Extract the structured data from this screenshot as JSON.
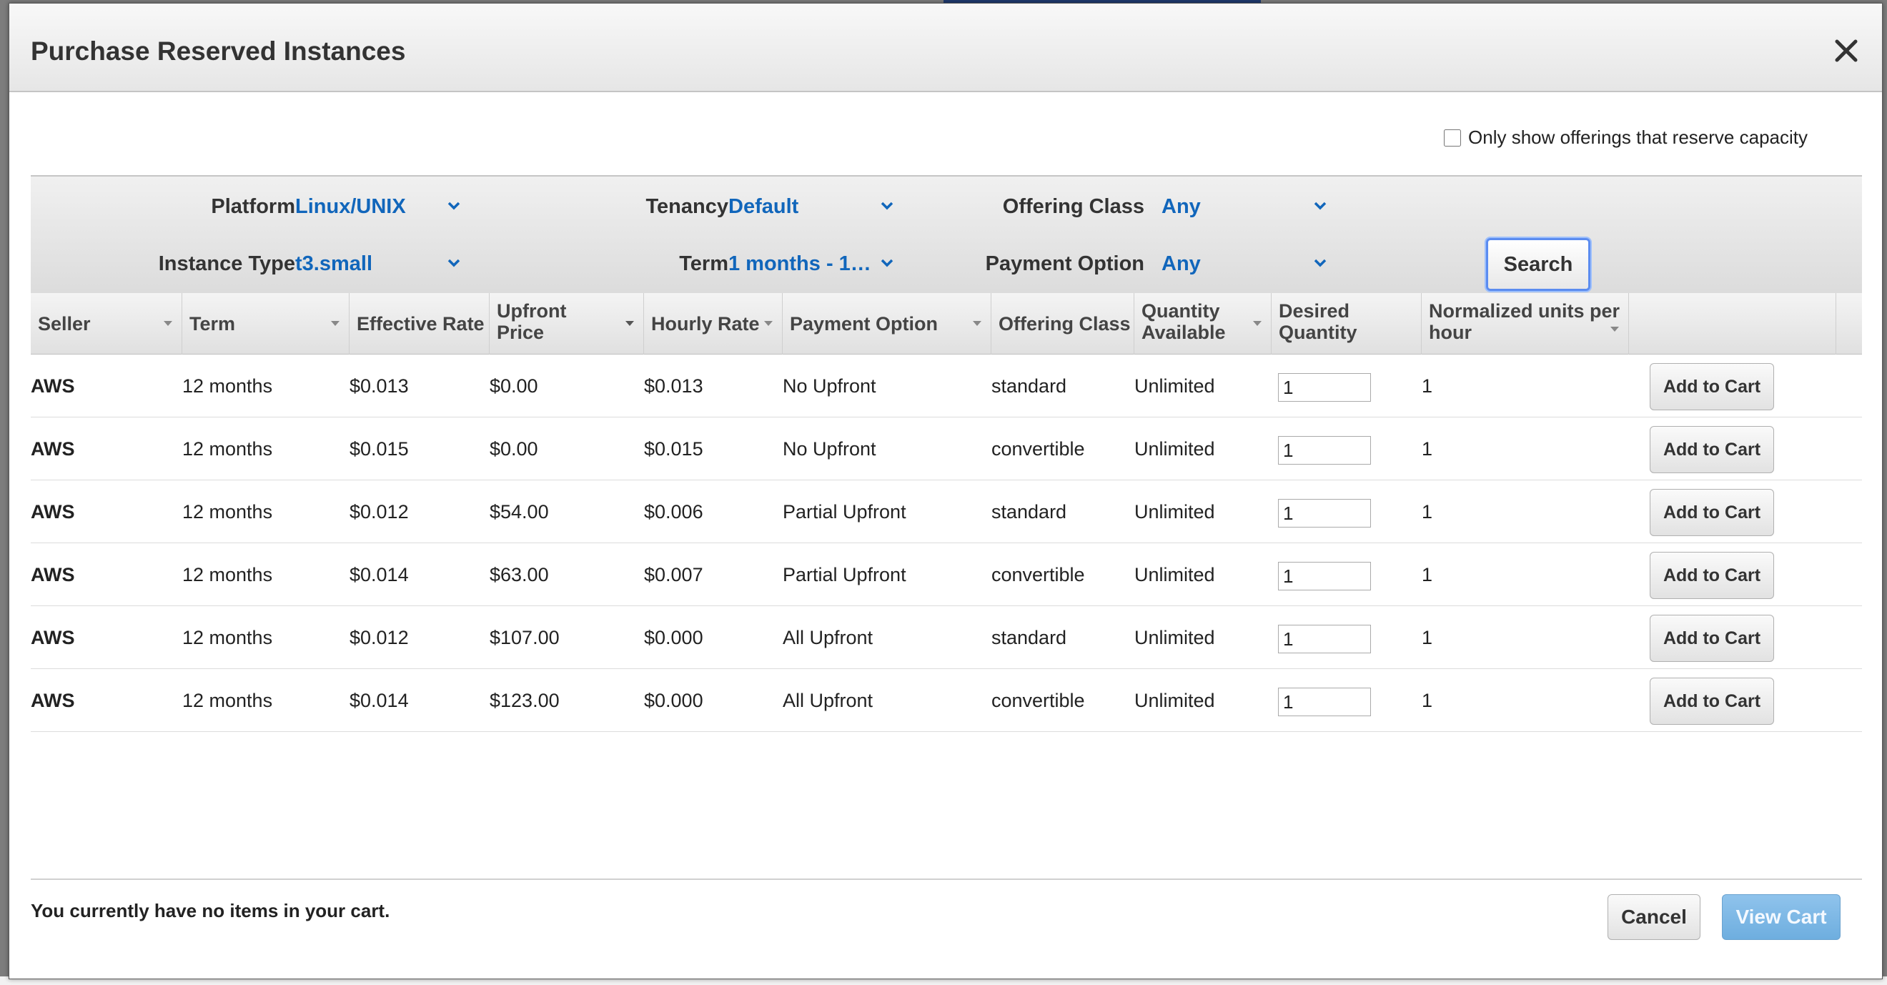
{
  "dialog": {
    "title": "Purchase Reserved Instances",
    "reserve_capacity_label": "Only show offerings that reserve capacity",
    "reserve_capacity_checked": false
  },
  "filters": {
    "platform": {
      "label": "Platform",
      "value": "Linux/UNIX"
    },
    "tenancy": {
      "label": "Tenancy",
      "value": "Default"
    },
    "offering_class": {
      "label": "Offering Class",
      "value": "Any"
    },
    "instance_type": {
      "label": "Instance Type",
      "value": "t3.small"
    },
    "term": {
      "label": "Term",
      "value": "1 months - 1…"
    },
    "payment_option": {
      "label": "Payment Option",
      "value": "Any"
    },
    "search_label": "Search"
  },
  "table": {
    "headers": {
      "seller": "Seller",
      "term": "Term",
      "effective_rate": "Effective Rate",
      "upfront_price": "Upfront Price",
      "hourly_rate": "Hourly Rate",
      "payment_option": "Payment Option",
      "offering_class": "Offering Class",
      "quantity_available": "Quantity Available",
      "desired_quantity": "Desired Quantity",
      "normalized_units": "Normalized units per hour"
    },
    "add_to_cart_label": "Add to Cart",
    "rows": [
      {
        "seller": "AWS",
        "term": "12 months",
        "effective_rate": "$0.013",
        "upfront_price": "$0.00",
        "hourly_rate": "$0.013",
        "payment_option": "No Upfront",
        "offering_class": "standard",
        "quantity_available": "Unlimited",
        "desired_quantity": "1",
        "normalized_units": "1"
      },
      {
        "seller": "AWS",
        "term": "12 months",
        "effective_rate": "$0.015",
        "upfront_price": "$0.00",
        "hourly_rate": "$0.015",
        "payment_option": "No Upfront",
        "offering_class": "convertible",
        "quantity_available": "Unlimited",
        "desired_quantity": "1",
        "normalized_units": "1"
      },
      {
        "seller": "AWS",
        "term": "12 months",
        "effective_rate": "$0.012",
        "upfront_price": "$54.00",
        "hourly_rate": "$0.006",
        "payment_option": "Partial Upfront",
        "offering_class": "standard",
        "quantity_available": "Unlimited",
        "desired_quantity": "1",
        "normalized_units": "1"
      },
      {
        "seller": "AWS",
        "term": "12 months",
        "effective_rate": "$0.014",
        "upfront_price": "$63.00",
        "hourly_rate": "$0.007",
        "payment_option": "Partial Upfront",
        "offering_class": "convertible",
        "quantity_available": "Unlimited",
        "desired_quantity": "1",
        "normalized_units": "1"
      },
      {
        "seller": "AWS",
        "term": "12 months",
        "effective_rate": "$0.012",
        "upfront_price": "$107.00",
        "hourly_rate": "$0.000",
        "payment_option": "All Upfront",
        "offering_class": "standard",
        "quantity_available": "Unlimited",
        "desired_quantity": "1",
        "normalized_units": "1"
      },
      {
        "seller": "AWS",
        "term": "12 months",
        "effective_rate": "$0.014",
        "upfront_price": "$123.00",
        "hourly_rate": "$0.000",
        "payment_option": "All Upfront",
        "offering_class": "convertible",
        "quantity_available": "Unlimited",
        "desired_quantity": "1",
        "normalized_units": "1"
      }
    ]
  },
  "footer": {
    "cart_message": "You currently have no items in your cart.",
    "cancel_label": "Cancel",
    "view_cart_label": "View Cart"
  },
  "colors": {
    "link_blue": "#1166bb",
    "primary_button_disabled": "#7ab6e4",
    "focus_ring": "#5b8cf0"
  }
}
